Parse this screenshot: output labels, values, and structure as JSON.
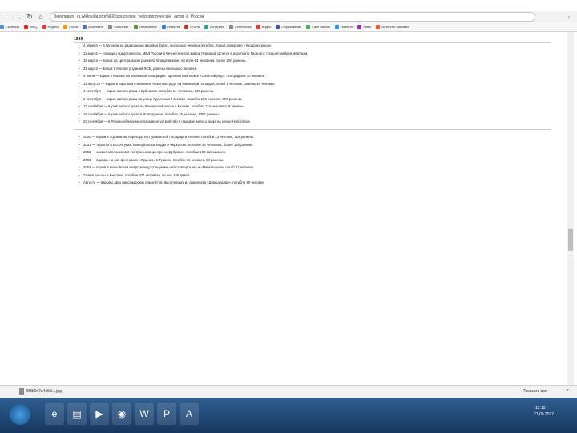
{
  "browser": {
    "address_text": "Википедия | ru.wikipedia.org/wiki/Хронология_террористических_актов_в_России",
    "bookmarks": [
      {
        "label": "Сервисы",
        "color": "#4a90d9"
      },
      {
        "label": "VidIQ",
        "color": "#e02424"
      },
      {
        "label": "Яндекс",
        "color": "#ff3333"
      },
      {
        "label": "Почта",
        "color": "#ff9800"
      },
      {
        "label": "ВКонтакте",
        "color": "#4c75a3"
      },
      {
        "label": "Классные",
        "color": "#8a8a8a"
      },
      {
        "label": "Управление",
        "color": "#5a8f3c"
      },
      {
        "label": "Новости",
        "color": "#2a7ae2"
      },
      {
        "label": "НОРМ",
        "color": "#c0392b"
      },
      {
        "label": "Интернет",
        "color": "#2aa198"
      },
      {
        "label": "Статистика",
        "color": "#888888"
      },
      {
        "label": "Видео",
        "color": "#e53935"
      },
      {
        "label": "Образование",
        "color": "#3f51b5"
      },
      {
        "label": "Сайт школы",
        "color": "#4caf50"
      },
      {
        "label": "Новости",
        "color": "#2196f3"
      },
      {
        "label": "Ревю",
        "color": "#9c27b0"
      },
      {
        "label": "Интернет-магазин",
        "color": "#ff5722"
      }
    ]
  },
  "article": {
    "year_heading": "1999",
    "events_group_1": [
      "4 апреля — в Грозном на радиорынке взорван фугас, несколько человек погибли. Взрыв совершён у входа на рынок.",
      "11 марта — похищен представитель МВД России в Чечне генерал-майор Геннадий Шпигун в аэропорту Грозного; позднее найден мёртвым.",
      "19 марта — взрыв на Центральном рынке во Владикавказе, погибли 64 человека, более 100 ранены.",
      "31 марта — взрыв в Москве у здания ФСБ, ранены несколько человек.",
      "4 июня — взрыв в Москве на Манежной площади в торговом комплексе «Охотный ряд». Пострадали 40 человек.",
      "31 августа — взрыв в торговом комплексе «Охотный ряд» на Манежной площади, погиб 1 человек, ранены 40 человек.",
      "4 сентября — взрыв жилого дома в Буйнакске, погибли 64 человека, 146 ранены.",
      "9 сентября — взрыв жилого дома на улице Гурьянова в Москве, погибли 106 человек, 690 ранены.",
      "13 сентября — взрыв жилого дома на Каширском шоссе в Москве, погибли 124 человека, 9 ранены.",
      "16 сентября — взрыв жилого дома в Волгодонске, погибли 19 человек, 1054 ранены.",
      "22 сентября — в Рязани обнаружено взрывное устройство в подвале жилого дома на улице Новосёлов."
    ],
    "events_group_2": [
      "2000 — взрыв в подземном переходе на Пушкинской площади в Москве, погибли 13 человек, 118 ранены.",
      "2001 — теракты в Ессентуках, Минеральных Водах и Черкесске, погибли 24 человека, более 140 ранены.",
      "2002 — захват заложников в театральном центре на Дубровке, погибли 130 заложников.",
      "2003 — взрывы на рок-фестивале «Крылья» в Тушино, погибли 16 человек, 60 ранены.",
      "2004 — взрыв в московском метро между станциями «Автозаводская» и «Павелецкая», погиб 41 человек.",
      "Захват школы в Беслане, погибли 334 человека, из них 186 детей.",
      "Августа — взрывы двух пассажирских самолётов, вылетевших из аэропорта «Домодедово», погибли 90 человек."
    ]
  },
  "downloads": {
    "file_name": "8f3b9c7a4e5d....jpg",
    "show_all": "Показать все"
  },
  "taskbar": {
    "time": "12:15",
    "date": "21.09.2017"
  }
}
